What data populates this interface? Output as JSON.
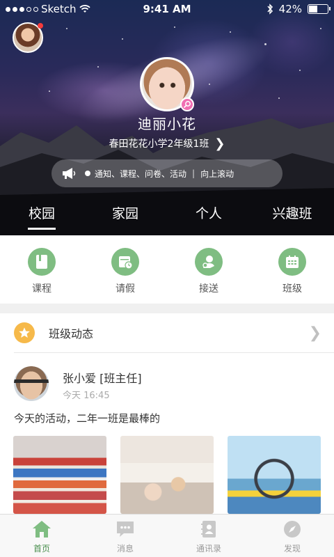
{
  "status_bar": {
    "carrier": "Sketch",
    "time": "9:41 AM",
    "battery_percent": "42%",
    "battery_level": 0.42
  },
  "profile": {
    "name": "迪丽小花",
    "school": "春田花花小学2年级1班"
  },
  "notice": {
    "text": "通知、课程、问卷、活动",
    "separator": "|",
    "hint": "向上滚动"
  },
  "tabs": [
    "校园",
    "家园",
    "个人",
    "兴趣班"
  ],
  "quick_actions": [
    {
      "label": "课程",
      "icon": "book-icon"
    },
    {
      "label": "请假",
      "icon": "calendar-clock-icon"
    },
    {
      "label": "接送",
      "icon": "pickup-person-icon"
    },
    {
      "label": "班级",
      "icon": "calendar-grid-icon"
    }
  ],
  "class_feed": {
    "title": "班级动态",
    "post": {
      "author": "张小爱 [班主任]",
      "time": "今天 16:45",
      "text": "今天的活动，二年一班是最棒的"
    }
  },
  "tabbar": [
    {
      "label": "首页",
      "icon": "home-icon",
      "active": true
    },
    {
      "label": "消息",
      "icon": "chat-icon",
      "active": false
    },
    {
      "label": "通讯录",
      "icon": "contacts-icon",
      "active": false
    },
    {
      "label": "发现",
      "icon": "compass-icon",
      "active": false
    }
  ],
  "colors": {
    "accent_green": "#7fbd82",
    "active_tab_green": "#4a8f4e",
    "star_orange": "#f6b94a",
    "avatar_badge_pink": "#f06fb3",
    "notification_red": "#f53b3b"
  }
}
